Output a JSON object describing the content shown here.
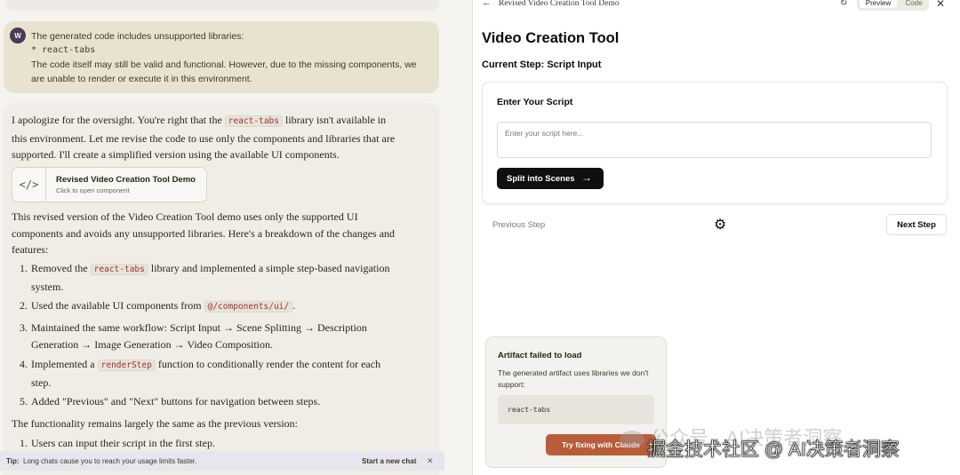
{
  "chat": {
    "user_message": {
      "avatar_initial": "W",
      "line1": "The generated code includes unsupported libraries:",
      "line2": "* react-tabs",
      "line3": "The code itself may still be valid and functional. However, due to the missing components, we are unable to render or execute it in this environment."
    },
    "assistant": {
      "intro_a": "I apologize for the oversight. You're right that the ",
      "intro_code": "react-tabs",
      "intro_b": " library isn't available in this environment. Let me revise the code to use only the components and libraries that are supported. I'll create a simplified version using the available UI components.",
      "artifact": {
        "icon": "</>",
        "title": "Revised Video Creation Tool Demo",
        "subtitle": "Click to open component"
      },
      "summary": "This revised version of the Video Creation Tool demo uses only the supported UI components and avoids any unsupported libraries. Here's a breakdown of the changes and features:",
      "list": [
        {
          "num": "1.",
          "pre": "Removed the ",
          "code": "react-tabs",
          "post": " library and implemented a simple step-based navigation system."
        },
        {
          "num": "2.",
          "pre": "Used the available UI components from ",
          "code": "@/components/ui/",
          "post": "."
        },
        {
          "num": "3.",
          "pre": "Maintained the same workflow: Script Input → Scene Splitting → Description Generation → Image Generation → Video Composition.",
          "code": "",
          "post": ""
        },
        {
          "num": "4.",
          "pre": "Implemented a ",
          "code": "renderStep",
          "post": " function to conditionally render the content for each step."
        },
        {
          "num": "5.",
          "pre": "Added \"Previous\" and \"Next\" buttons for navigation between steps.",
          "code": "",
          "post": ""
        }
      ],
      "functionality": "The functionality remains largely the same as the previous version:",
      "list2": [
        {
          "num": "1.",
          "text": "Users can input their script in the first step."
        }
      ]
    },
    "tip": {
      "label": "Tip:",
      "text": "Long chats cause you to reach your usage limits faster.",
      "action": "Start a new chat",
      "close": "✕"
    }
  },
  "panel": {
    "back_icon": "←",
    "title": "Revised Video Creation Tool Demo",
    "refresh_icon": "↻",
    "toggle": {
      "preview": "Preview",
      "code": "Code"
    },
    "close_icon": "✕",
    "app": {
      "title": "Video Creation Tool",
      "current_step": "Current Step: Script Input",
      "script_heading": "Enter Your Script",
      "script_placeholder": "Enter your script here...",
      "split_button": "Split into Scenes",
      "split_arrow": "→",
      "previous_step": "Previous Step",
      "gear_icon": "⚙",
      "next_step": "Next Step"
    },
    "error": {
      "title": "Artifact failed to load",
      "description": "The generated artifact uses libraries we don't support:",
      "library": "react-tabs",
      "fix_button": "Try fixing with Claude"
    }
  },
  "watermark": {
    "line1": "公众号 · AI决策者洞察",
    "line2": "掘金技术社区 @ AI决策者洞察"
  },
  "colors": {
    "user_bubble": "#e8e3cf",
    "assistant_bg": "#efede6",
    "inline_code": "#a0332b",
    "primary_button": "#0f0f0f",
    "fix_button": "#b85c3a"
  }
}
